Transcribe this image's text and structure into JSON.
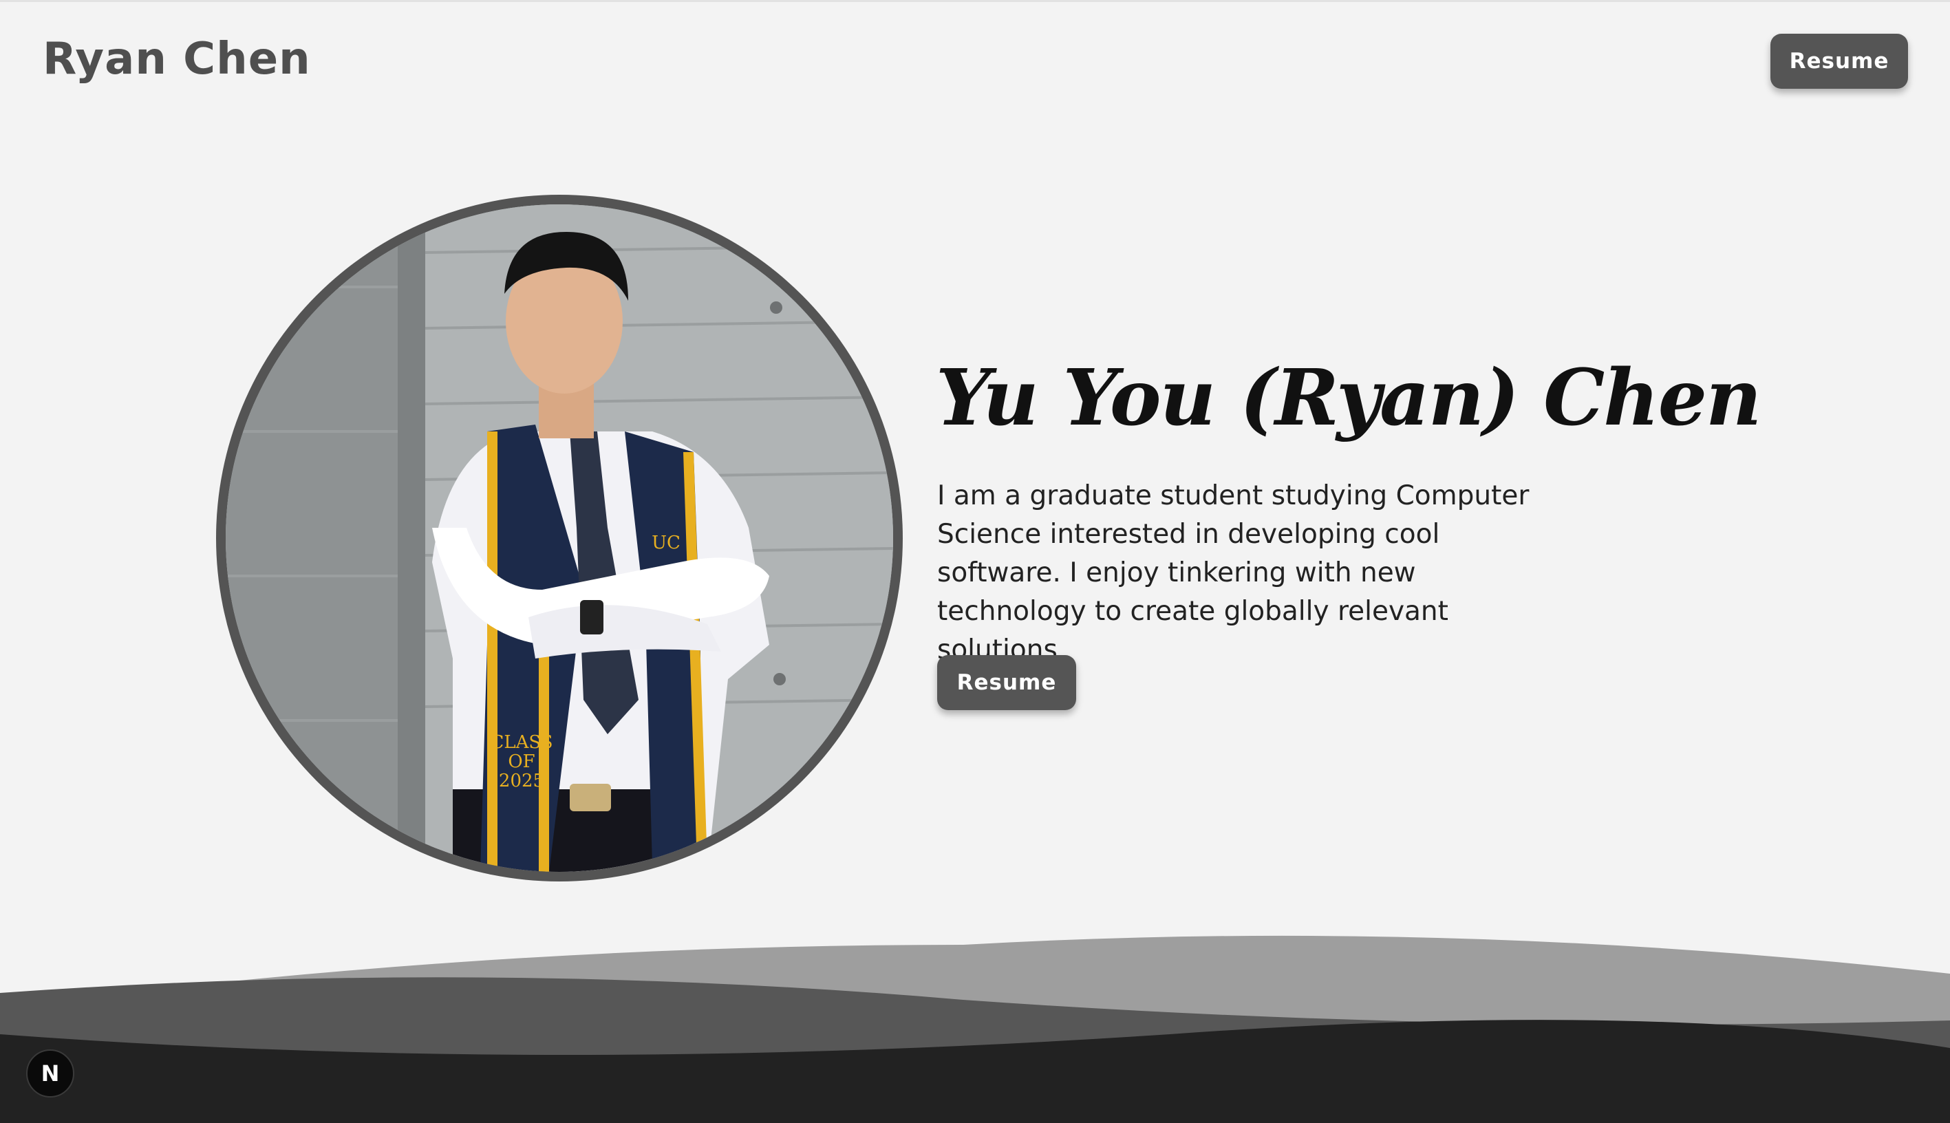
{
  "header": {
    "site_title": "Ryan Chen",
    "resume_label": "Resume"
  },
  "hero": {
    "name": "Yu You (Ryan) Chen",
    "bio": "I am a graduate student studying Computer Science interested in developing cool software. I enjoy tinkering with new technology to create globally relevant solutions.",
    "resume_label": "Resume",
    "portrait": {
      "stole_text_line1": "CLASS",
      "stole_text_line2": "OF",
      "stole_text_line3": "2025",
      "stole_letters": "UC"
    }
  },
  "footer": {
    "next_badge": "N"
  },
  "colors": {
    "background": "#f3f3f3",
    "button": "#555555",
    "wave_light": "#9e9e9e",
    "wave_mid": "#575757",
    "wave_dark": "#222222",
    "stole_navy": "#1c2a4a",
    "stole_gold": "#e8b020"
  }
}
